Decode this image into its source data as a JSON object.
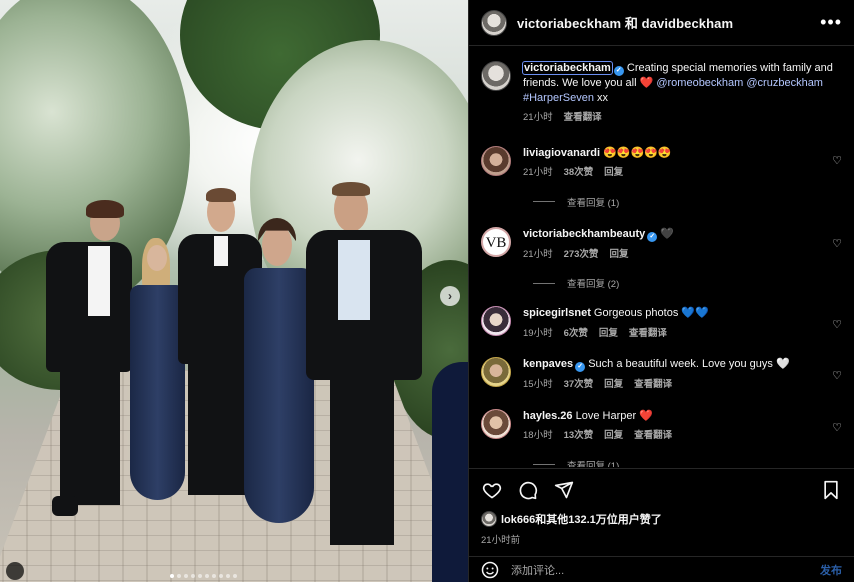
{
  "header": {
    "title": "victoriabeckham 和 davidbeckham",
    "more_label": "•••"
  },
  "caption": {
    "username": "victoriabeckham",
    "text": "Creating special memories with family and friends. We love you all ❤️",
    "mention1": "@romeobeckham",
    "mention2": "@cruzbeckham",
    "hashtag": "#HarperSeven",
    "tail": "xx",
    "time": "21小时",
    "translate": "查看翻译"
  },
  "comments": [
    {
      "username": "liviagiovanardi",
      "verified": false,
      "text": "😍😍😍😍😍",
      "time": "21小时",
      "likes": "38次赞",
      "reply": "回复",
      "translate": "",
      "replies_label": "查看回复 (1)"
    },
    {
      "username": "victoriabeckhambeauty",
      "verified": true,
      "text": "🖤",
      "time": "21小时",
      "likes": "273次赞",
      "reply": "回复",
      "translate": "",
      "replies_label": "查看回复 (2)"
    },
    {
      "username": "spicegirlsnet",
      "verified": false,
      "text": "Gorgeous photos 💙💙",
      "time": "19小时",
      "likes": "6次赞",
      "reply": "回复",
      "translate": "查看翻译",
      "replies_label": ""
    },
    {
      "username": "kenpaves",
      "verified": true,
      "text": "Such a beautiful week. Love you guys 🤍",
      "time": "15小时",
      "likes": "37次赞",
      "reply": "回复",
      "translate": "查看翻译",
      "replies_label": ""
    },
    {
      "username": "hayles.26",
      "verified": false,
      "text": "Love Harper ❤️",
      "time": "18小时",
      "likes": "13次赞",
      "reply": "回复",
      "translate": "查看翻译",
      "replies_label": "查看回复 (1)"
    }
  ],
  "monogram": "VB",
  "likes_text": "lok666和其他132.1万位用户赞了",
  "post_time": "21小时前",
  "add_comment": {
    "placeholder": "添加评论...",
    "post": "发布"
  },
  "photo_nav": "›",
  "colors": {
    "accent": "#3897f0",
    "link": "#b4c7ff",
    "background": "#000000"
  }
}
